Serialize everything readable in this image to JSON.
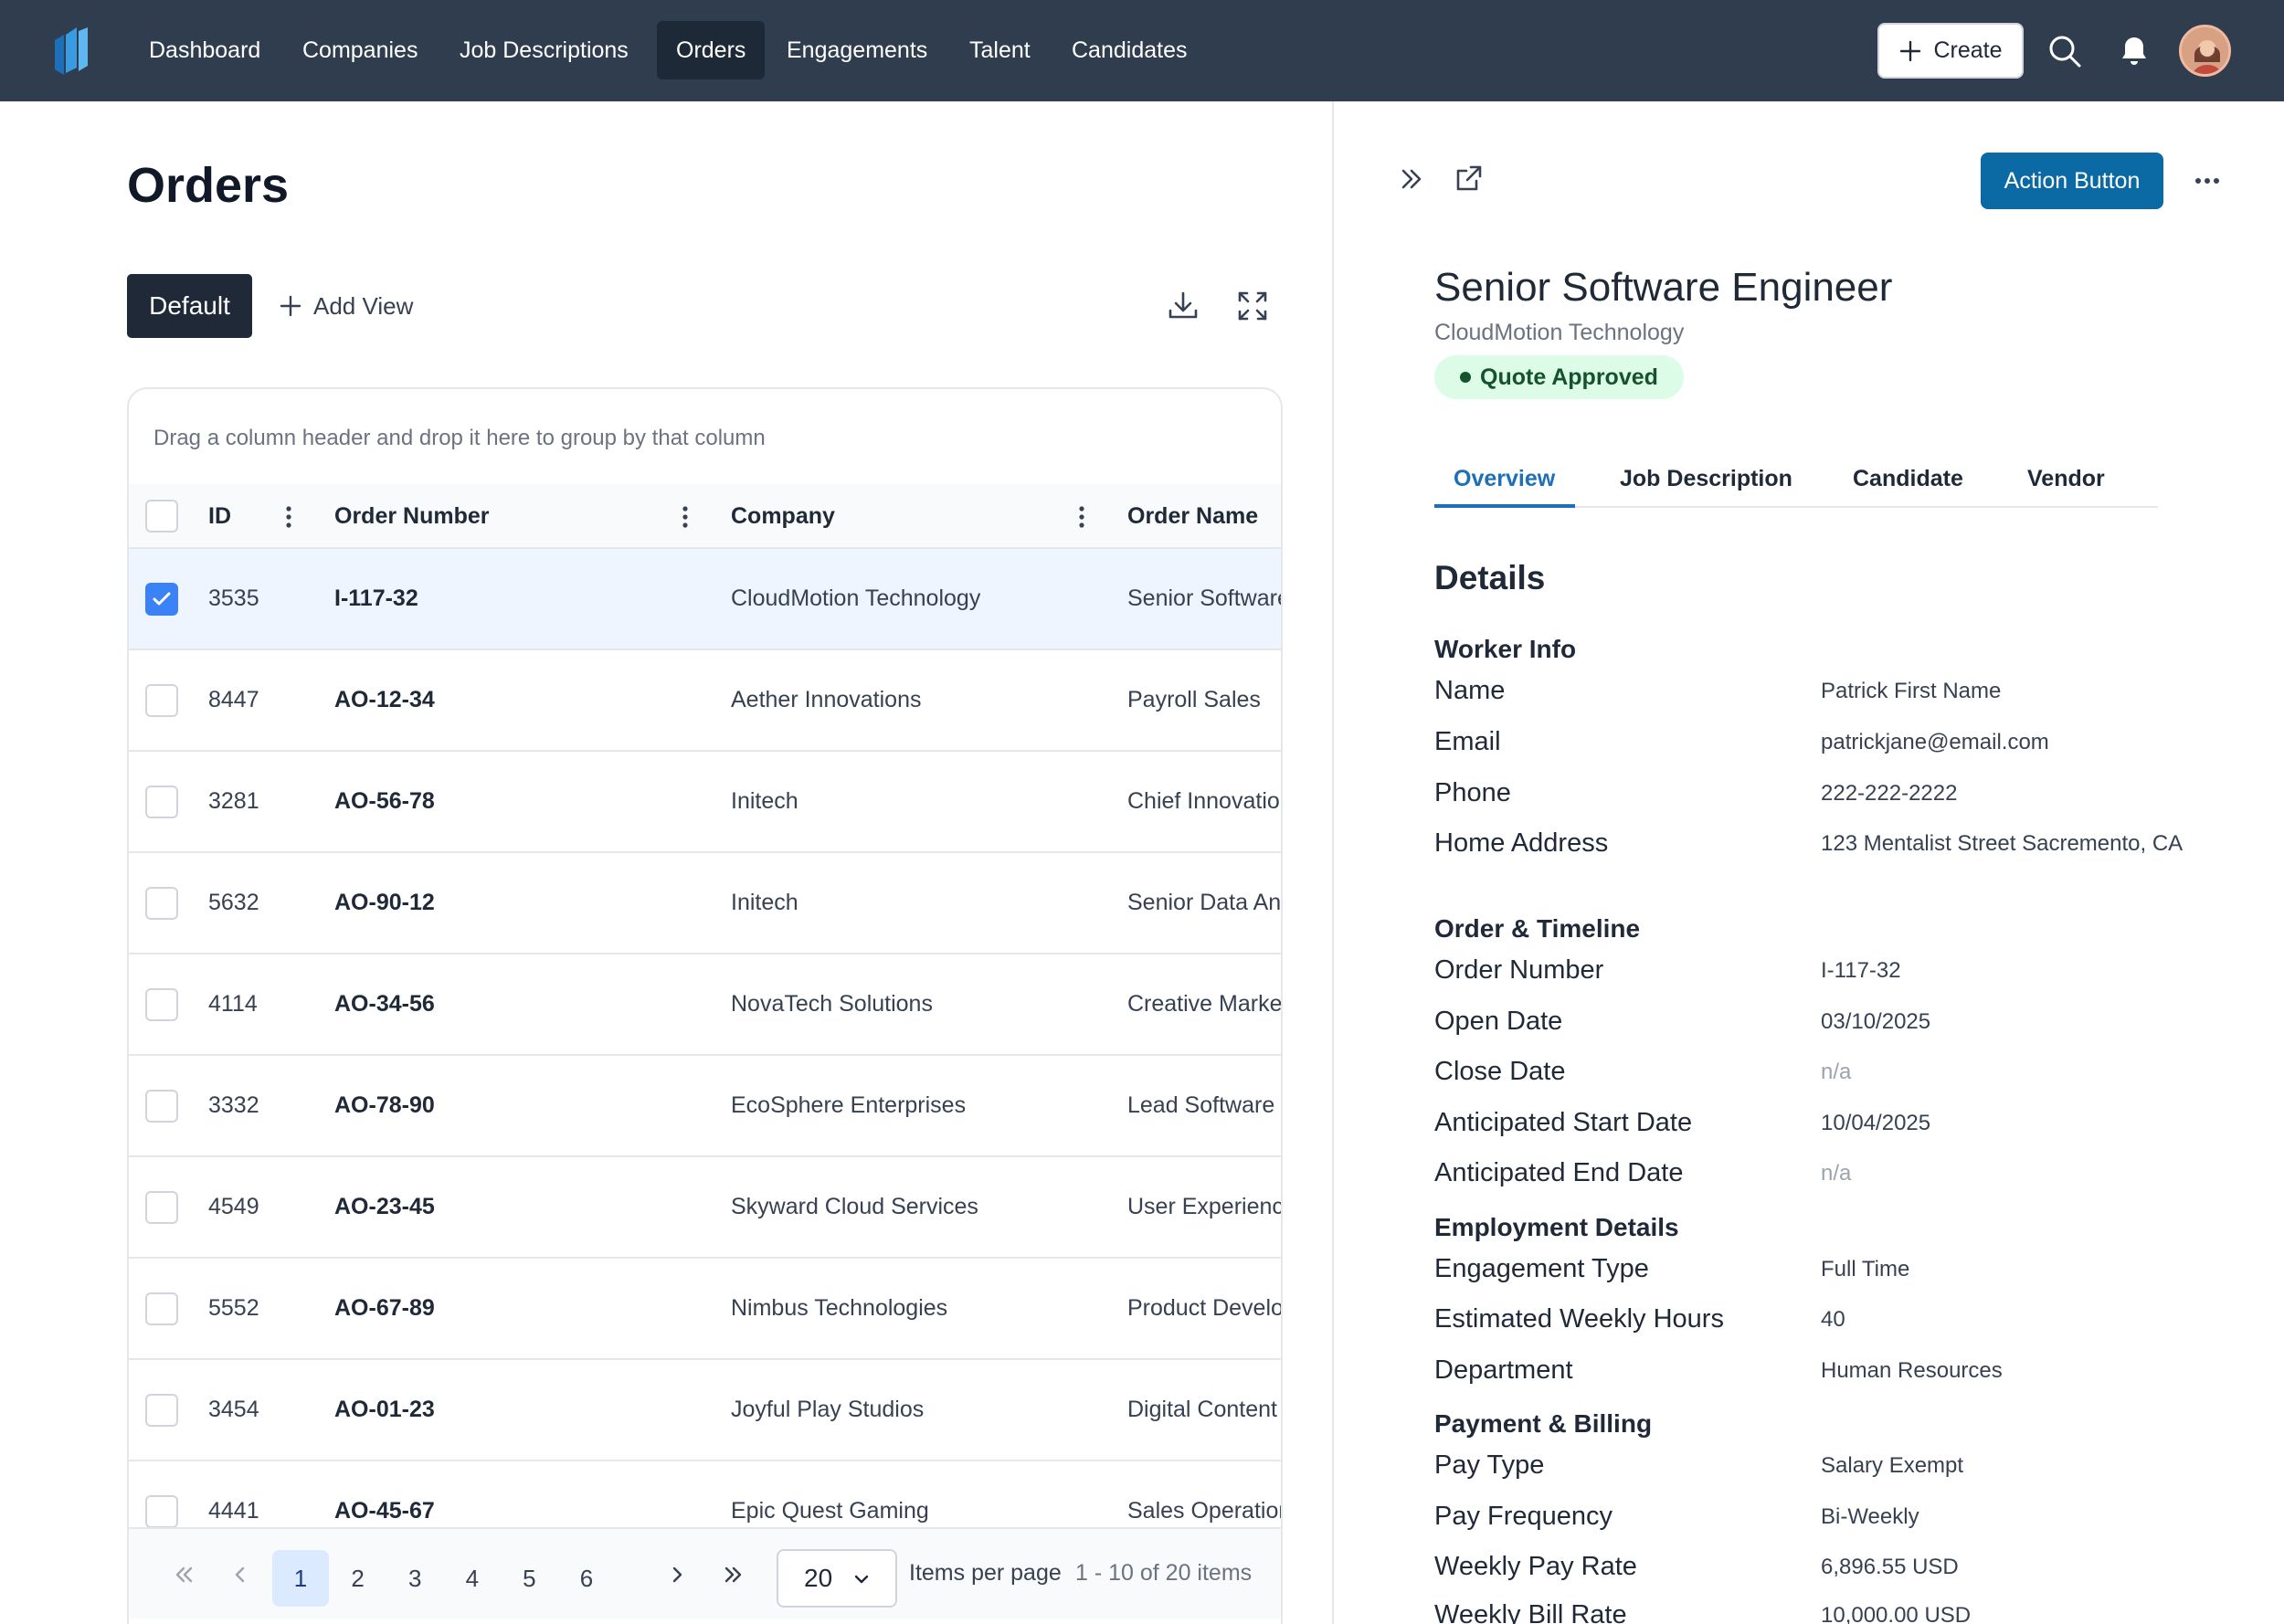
{
  "nav": {
    "items": [
      {
        "label": "Dashboard",
        "active": false
      },
      {
        "label": "Companies",
        "active": false
      },
      {
        "label": "Job Descriptions",
        "active": false
      },
      {
        "label": "Orders",
        "active": true
      },
      {
        "label": "Engagements",
        "active": false
      },
      {
        "label": "Talent",
        "active": false
      },
      {
        "label": "Candidates",
        "active": false
      }
    ],
    "create_label": "Create",
    "icons": [
      "plus-icon",
      "search-icon",
      "bell-icon",
      "avatar"
    ]
  },
  "page": {
    "title": "Orders",
    "views": {
      "default_label": "Default",
      "add_label": "Add View"
    },
    "toolbar_icons": [
      "download-icon",
      "fullscreen-icon"
    ]
  },
  "grid": {
    "group_hint": "Drag a column header and drop it here to group by that column",
    "columns": [
      "ID",
      "Order Number",
      "Company",
      "Order Name"
    ],
    "rows": [
      {
        "id": "3535",
        "order_number": "I-117-32",
        "company": "CloudMotion Technology",
        "order_name": "Senior Software Engineer",
        "selected": true
      },
      {
        "id": "8447",
        "order_number": "AO-12-34",
        "company": "Aether Innovations",
        "order_name": "Payroll Sales",
        "selected": false
      },
      {
        "id": "3281",
        "order_number": "AO-56-78",
        "company": "Initech",
        "order_name": "Chief Innovation",
        "selected": false
      },
      {
        "id": "5632",
        "order_number": "AO-90-12",
        "company": "Initech",
        "order_name": "Senior Data Analyst",
        "selected": false
      },
      {
        "id": "4114",
        "order_number": "AO-34-56",
        "company": "NovaTech Solutions",
        "order_name": "Creative Marketing",
        "selected": false
      },
      {
        "id": "3332",
        "order_number": "AO-78-90",
        "company": "EcoSphere Enterprises",
        "order_name": "Lead Software",
        "selected": false
      },
      {
        "id": "4549",
        "order_number": "AO-23-45",
        "company": "Skyward Cloud Services",
        "order_name": "User Experience",
        "selected": false
      },
      {
        "id": "5552",
        "order_number": "AO-67-89",
        "company": "Nimbus Technologies",
        "order_name": "Product Development",
        "selected": false
      },
      {
        "id": "3454",
        "order_number": "AO-01-23",
        "company": "Joyful Play Studios",
        "order_name": "Digital Content",
        "selected": false
      },
      {
        "id": "4441",
        "order_number": "AO-45-67",
        "company": "Epic Quest Gaming",
        "order_name": "Sales Operations",
        "selected": false
      }
    ]
  },
  "pager": {
    "pages": [
      "1",
      "2",
      "3",
      "4",
      "5",
      "6"
    ],
    "current_page": "1",
    "per_page": "20",
    "per_page_label": "Items per page",
    "range_text": "1 - 10 of 20 items"
  },
  "detail": {
    "action_label": "Action Button",
    "title": "Senior Software Engineer",
    "company": "CloudMotion Technology",
    "status": "Quote Approved",
    "status_color": "#dcfce7",
    "tabs": [
      "Overview",
      "Job Description",
      "Candidate",
      "Vendor"
    ],
    "active_tab": "Overview",
    "details_heading": "Details",
    "sections": {
      "worker": {
        "heading": "Worker Info",
        "name_label": "Name",
        "name": "Patrick First Name",
        "email_label": "Email",
        "email": "patrickjane@email.com",
        "phone_label": "Phone",
        "phone": "222-222-2222",
        "address_label": "Home Address",
        "address": "123 Mentalist Street Sacremento, CA"
      },
      "order": {
        "heading": "Order & Timeline",
        "order_number_label": "Order Number",
        "order_number": "I-117-32",
        "open_date_label": "Open Date",
        "open_date": "03/10/2025",
        "close_date_label": "Close Date",
        "close_date": "n/a",
        "start_label": "Anticipated Start Date",
        "start": "10/04/2025",
        "end_label": "Anticipated End Date",
        "end": "n/a"
      },
      "employment": {
        "heading": "Employment Details",
        "type_label": "Engagement Type",
        "type": "Full Time",
        "hours_label": "Estimated Weekly Hours",
        "hours": "40",
        "dept_label": "Department",
        "dept": "Human Resources"
      },
      "payment": {
        "heading": "Payment & Billing",
        "pay_type_label": "Pay Type",
        "pay_type": "Salary Exempt",
        "freq_label": "Pay Frequency",
        "freq": "Bi-Weekly",
        "pay_rate_label": "Weekly Pay Rate",
        "pay_rate": "6,896.55 USD",
        "bill_rate_label": "Weekly Bill Rate",
        "bill_rate": "10,000.00 USD"
      }
    }
  },
  "colors": {
    "nav_bg": "#2f3d4f",
    "accent": "#0b69a3",
    "selected_row": "#eef5ff",
    "checkbox_checked": "#3b82f6"
  }
}
